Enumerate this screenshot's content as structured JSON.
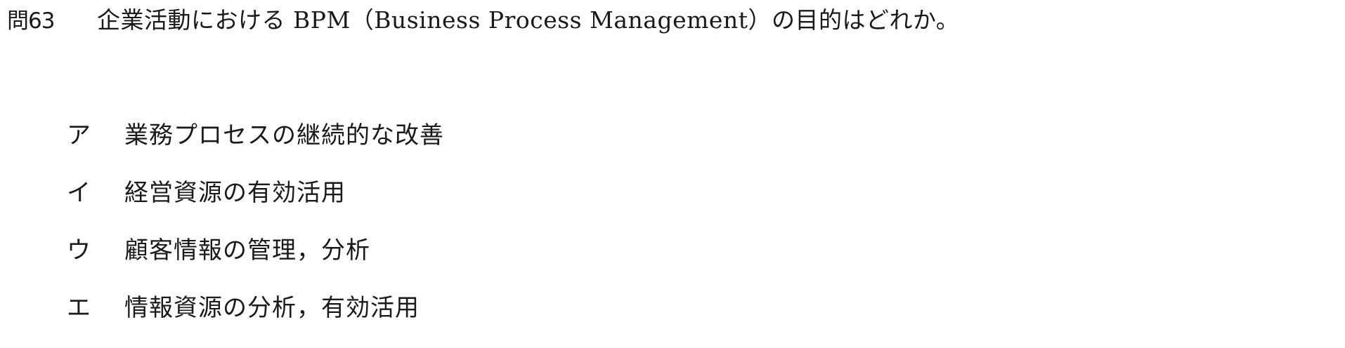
{
  "question": {
    "number": "問63",
    "text": "企業活動における BPM（Business Process Management）の目的はどれか。"
  },
  "choices": [
    {
      "label": "ア",
      "text": "業務プロセスの継続的な改善"
    },
    {
      "label": "イ",
      "text": "経営資源の有効活用"
    },
    {
      "label": "ウ",
      "text": "顧客情報の管理，分析"
    },
    {
      "label": "エ",
      "text": "情報資源の分析，有効活用"
    }
  ]
}
